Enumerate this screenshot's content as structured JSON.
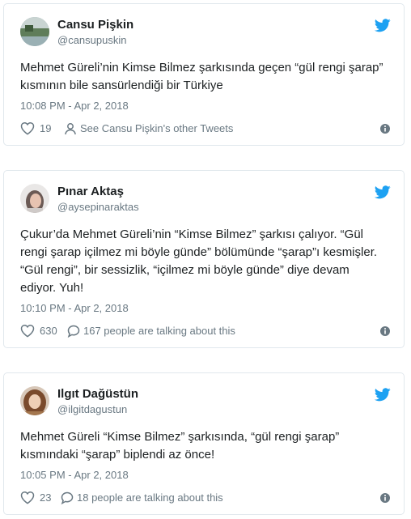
{
  "tweets": [
    {
      "name": "Cansu Pişkin",
      "handle": "@cansupuskin",
      "text": "Mehmet Güreli’nin Kimse Bilmez şarkısında geçen “gül rengi şarap” kısmının bile sansürlendiği bir Türkiye",
      "timestamp": "10:08 PM - Apr 2, 2018",
      "likes": "19",
      "secondary": "See Cansu Pişkin's other Tweets",
      "secondary_icon": "person-icon"
    },
    {
      "name": "Pınar Aktaş",
      "handle": "@aysepinaraktas",
      "text": "Çukur’da Mehmet Güreli’nin “Kimse Bilmez” şarkısı çalıyor. “Gül rengi şarap içilmez mi böyle günde” bölümünde “şarap”ı kesmişler. “Gül rengi”, bir sessizlik, “içilmez mi böyle günde” diye devam ediyor. Yuh!",
      "timestamp": "10:10 PM - Apr 2, 2018",
      "likes": "630",
      "secondary": "167 people are talking about this",
      "secondary_icon": "speech-bubble-icon"
    },
    {
      "name": "Ilgıt Dağüstün",
      "handle": "@ilgitdagustun",
      "text": "Mehmet Güreli “Kimse Bilmez” şarkısında, “gül rengi şarap” kısmındaki “şarap” biplendi az önce!",
      "timestamp": "10:05 PM - Apr 2, 2018",
      "likes": "23",
      "secondary": "18 people are talking about this",
      "secondary_icon": "speech-bubble-icon"
    }
  ],
  "colors": {
    "twitter_blue": "#1da1f2",
    "meta_gray": "#697882",
    "border": "#e1e8ed"
  }
}
